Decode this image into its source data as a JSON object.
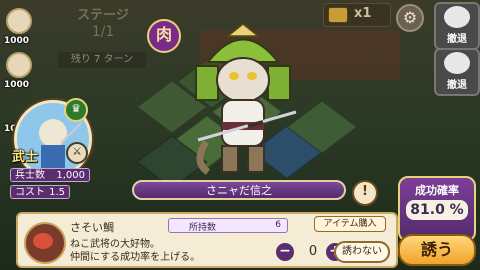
{
  "stage": {
    "title": "ステージ",
    "count": "1/1",
    "turns": "残り 7 ターン"
  },
  "roster": [
    {
      "value": "1000"
    },
    {
      "value": "1000"
    },
    {
      "value": "1000"
    }
  ],
  "top": {
    "currency": "x1",
    "retreat_label": "撤退"
  },
  "paw_badge": "肉",
  "selected_unit": {
    "class": "武士",
    "stats": [
      {
        "label": "兵士数",
        "value": "1,000"
      },
      {
        "label": "コスト",
        "value": "1.5"
      }
    ]
  },
  "target": {
    "name": "さニャだ信之"
  },
  "info_icon": "!",
  "success": {
    "title": "成功確率",
    "value": "81.0 %"
  },
  "item": {
    "name": "さそい鯛",
    "owned_label": "所持数",
    "owned_value": "6",
    "buy_label": "アイテム購入",
    "desc_line1": "ねこ武将の大好物。",
    "desc_line2": "仲間にする成功率を上げる。",
    "quantity": "0",
    "minus": "−",
    "plus": "+",
    "no_invite": "誘わない"
  },
  "invite_button": "誘う",
  "colors": {
    "accent_purple": "#5a2d6e",
    "gold": "#e9d27a",
    "panel": "#f5ecd6"
  }
}
